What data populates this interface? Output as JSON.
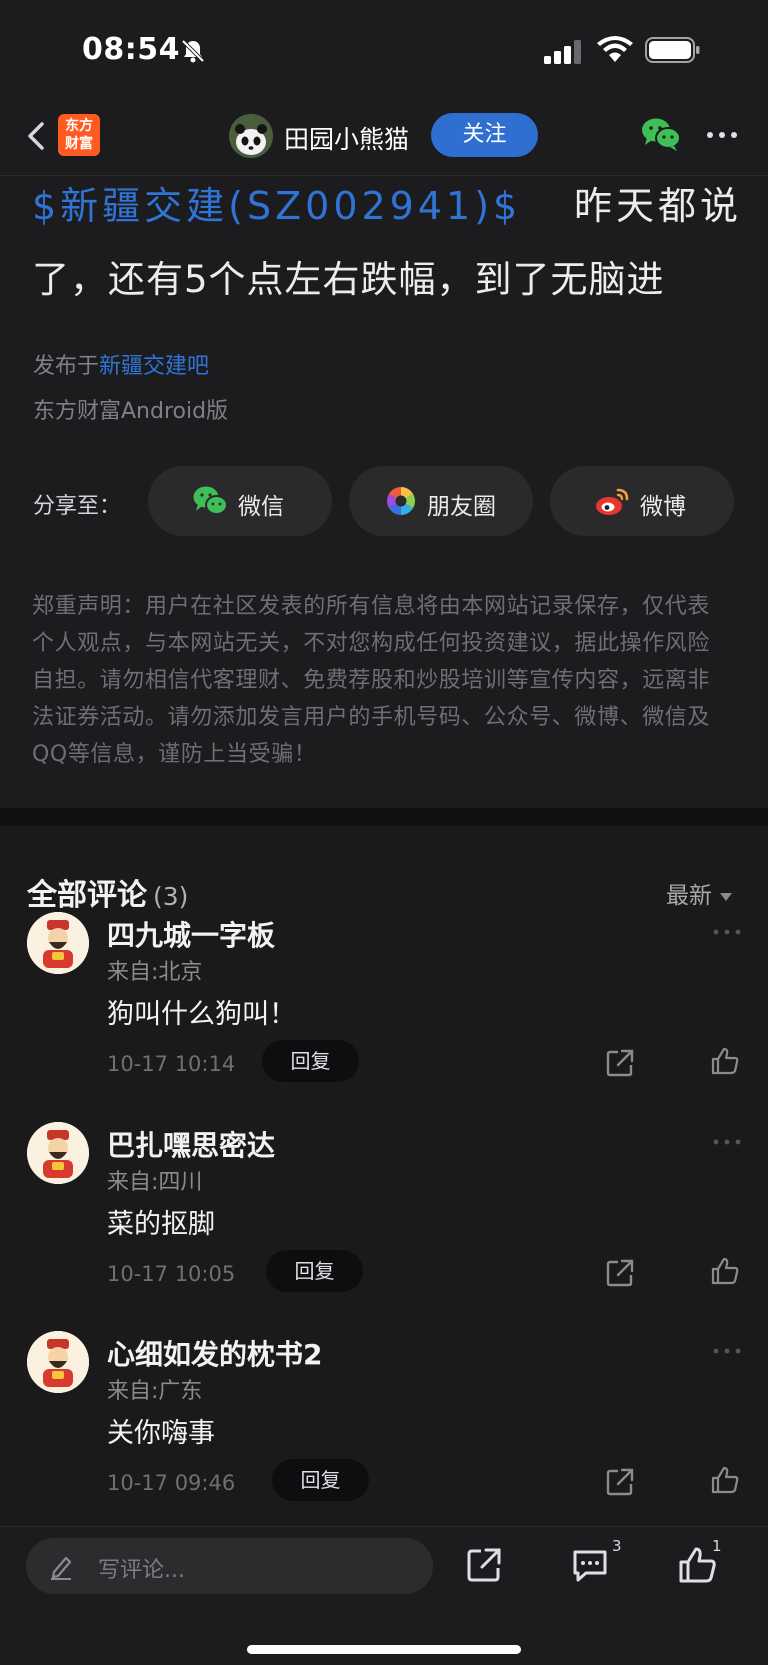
{
  "status_bar": {
    "time": "08:54",
    "icons": [
      "bell-slash-icon",
      "signal-icon",
      "wifi-icon",
      "battery-icon"
    ]
  },
  "nav": {
    "app_logo_text_line1": "东方",
    "app_logo_text_line2": "财富",
    "author_name": "田园小熊猫",
    "follow_label": "关注"
  },
  "post": {
    "stock_link": "$新疆交建(SZ002941)$",
    "line1_tail": "昨天都说",
    "line2": "了，还有5个点左右跌幅，到了无脑进",
    "published_prefix": "发布于",
    "forum_name": "新疆交建吧",
    "device": "东方财富Android版"
  },
  "share": {
    "label": "分享至：",
    "options": [
      {
        "label": "微信",
        "icon": "wechat-icon"
      },
      {
        "label": "朋友圈",
        "icon": "moments-icon"
      },
      {
        "label": "微博",
        "icon": "weibo-icon"
      }
    ]
  },
  "disclaimer": "郑重声明：用户在社区发表的所有信息将由本网站记录保存，仅代表个人观点，与本网站无关，不对您构成任何投资建议，据此操作风险自担。请勿相信代客理财、免费荐股和炒股培训等宣传内容，远离非法证券活动。请勿添加发言用户的手机号码、公众号、微博、微信及QQ等信息，谨防上当受骗！",
  "comments": {
    "title": "全部评论",
    "count": "(3)",
    "sort_label": "最新",
    "items": [
      {
        "user": "四九城一字板",
        "location": "来自:北京",
        "text": "狗叫什么狗叫！",
        "time": "10-17 10:14",
        "reply_label": "回复"
      },
      {
        "user": "巴扎嘿思密达",
        "location": "来自:四川",
        "text": "菜的抠脚",
        "time": "10-17 10:05",
        "reply_label": "回复"
      },
      {
        "user": "心细如发的枕书2",
        "location": "来自:广东",
        "text": "关你嗨事",
        "time": "10-17 09:46",
        "reply_label": "回复"
      }
    ]
  },
  "bottom_bar": {
    "input_placeholder": "写评论...",
    "comment_count": "3",
    "like_count": "1"
  },
  "colors": {
    "accent_blue": "#2e6fd0",
    "link_blue": "#2f74d6",
    "background": "#1c1c1e",
    "app_logo_orange": "#ff5a1f"
  }
}
